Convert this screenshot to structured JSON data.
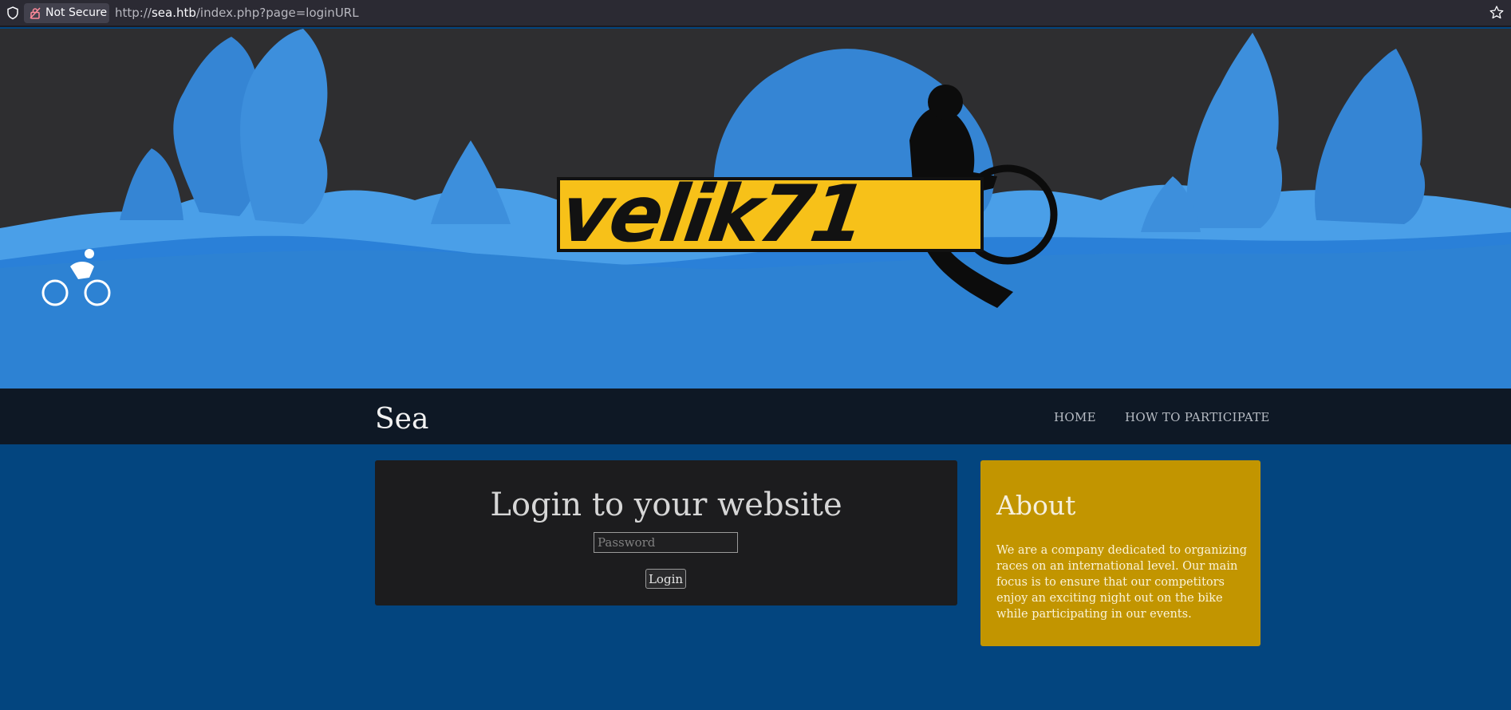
{
  "browser": {
    "security_label": "Not Secure",
    "url_scheme": "http://",
    "url_host": "sea.htb",
    "url_path": "/index.php?page=loginURL"
  },
  "hero": {
    "logo_text": "velik71",
    "colors": {
      "sky": "#2e2e30",
      "trees": "#2f7fc9",
      "ground": "#2a80d8",
      "logo_bg": "#f7c119"
    }
  },
  "nav": {
    "brand": "Sea",
    "items": [
      {
        "label": "HOME"
      },
      {
        "label": "HOW TO PARTICIPATE"
      }
    ]
  },
  "login": {
    "title": "Login to your website",
    "password_placeholder": "Password",
    "password_value": "",
    "button_label": "Login"
  },
  "about": {
    "title": "About",
    "text": "We are a company dedicated to organizing races on an international level. Our main focus is to ensure that our competitors enjoy an exciting night out on the bike while participating in our events."
  },
  "colors": {
    "page_bg": "#03457f",
    "nav_bg": "#0e1825",
    "card_bg": "#1c1c1e",
    "about_bg": "#c29500"
  }
}
